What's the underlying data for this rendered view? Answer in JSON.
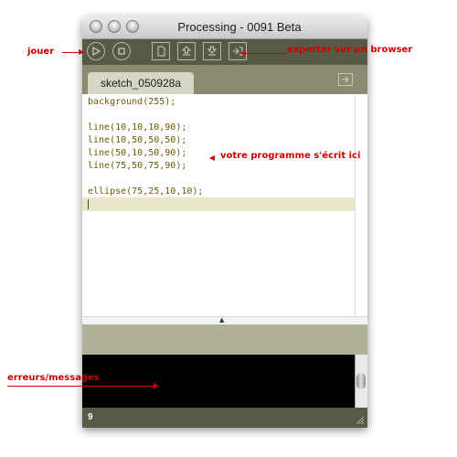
{
  "window": {
    "title": "Processing - 0091 Beta"
  },
  "toolbar": {
    "buttons": [
      {
        "icon": "play-icon"
      },
      {
        "icon": "stop-icon"
      },
      {
        "icon": "new-icon"
      },
      {
        "icon": "open-icon"
      },
      {
        "icon": "save-icon"
      },
      {
        "icon": "export-icon"
      }
    ]
  },
  "tabs": {
    "active": "sketch_050928a"
  },
  "editor": {
    "lines": [
      "background(255);",
      "",
      "line(10,10,10,90);",
      "line(10,50,50,50);",
      "line(50,10,50,90);",
      "line(75,50,75,90);",
      "",
      "ellipse(75,25,10,10);",
      ""
    ]
  },
  "footer": {
    "line_number": "9"
  },
  "annotations": {
    "play": "jouer",
    "export": "exporter sur un browser",
    "editor": "votre programme s'écrit ici",
    "console": "erreurs/messages"
  },
  "colors": {
    "annotation": "#cc0000",
    "toolbar": "#585a45",
    "code_text": "#6a5a00"
  }
}
